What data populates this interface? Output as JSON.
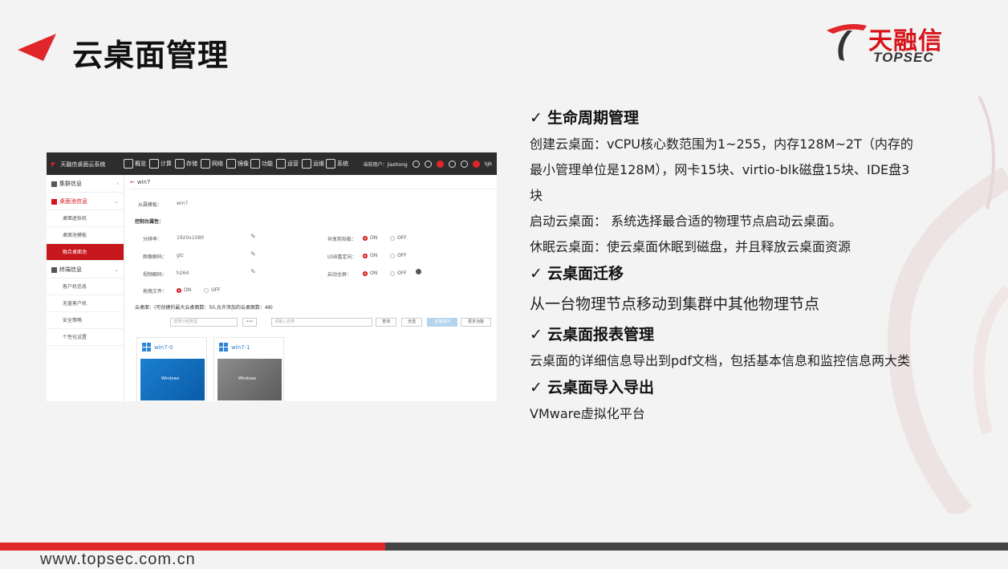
{
  "slide": {
    "title": "云桌面管理",
    "logo_cn": "天融信",
    "logo_en": "TOPSEC",
    "footer_url": "www.topsec.com.cn",
    "accent": "#e0262b"
  },
  "sections": [
    {
      "heading": "生命周期管理",
      "paragraphs": [
        "创建云桌面：vCPU核心数范围为1~255，内存128M~2T（内存的",
        "最小管理单位是128M），网卡15块、virtio-blk磁盘15块、IDE盘3",
        "块",
        "启动云桌面： 系统选择最合适的物理节点启动云桌面。",
        "休眠云桌面：使云桌面休眠到磁盘，并且释放云桌面资源"
      ]
    },
    {
      "heading": "云桌面迁移",
      "paragraphs": [
        "从一台物理节点移动到集群中其他物理节点"
      ]
    },
    {
      "heading": "云桌面报表管理",
      "paragraphs": [
        "云桌面的详细信息导出到pdf文档，包括基本信息和监控信息两大类"
      ]
    },
    {
      "heading": "云桌面导入导出",
      "paragraphs": [
        "VMware虚拟化平台"
      ]
    }
  ],
  "app": {
    "brand": "天融信桌面云系统",
    "nav": [
      "概览",
      "计算",
      "存储",
      "网络",
      "镜像",
      "功能",
      "运营",
      "运维",
      "系统"
    ],
    "user": "当前用户：jiashong",
    "user_short": "lgb",
    "sidebar": {
      "group1": "集群信息",
      "group2": "桌面池信息",
      "group2_items": [
        "桌面虚拟机",
        "桌面池模板",
        "融合桌面池"
      ],
      "group3": "终端信息",
      "group3_items": [
        "客户机信息",
        "无盘客户机",
        "安全策略",
        "个性化设置"
      ]
    },
    "crumb": "win7",
    "template_label": "从属模板：",
    "template_value": "win7",
    "console_label": "控制台属性：",
    "fields": {
      "resolution_label": "分辨率：",
      "resolution_value": "1920x1080",
      "image_codec_label": "图像解码：",
      "image_codec_value": "glz",
      "video_codec_label": "视频解码：",
      "video_codec_value": "h264",
      "drag_label": "拖拽文件：",
      "clipboard_label": "共享剪贴板：",
      "usb_label": "USB重定向：",
      "fullscreen_label": "启动全屏：",
      "on": "ON",
      "off": "OFF"
    },
    "desktops_label": "云桌面：(可创建的最大云桌面数：50,允许添加的云桌面数：48)",
    "filter_placeholder": "选择分组类型",
    "name_placeholder": "请输入名称",
    "buttons": {
      "more": "•••",
      "query": "查询",
      "select_all": "全选",
      "batch": "批量操作",
      "more_func": "更多功能"
    },
    "cards": [
      {
        "name": "win7-0"
      },
      {
        "name": "win7-1"
      }
    ],
    "windows_label": "Windows"
  }
}
